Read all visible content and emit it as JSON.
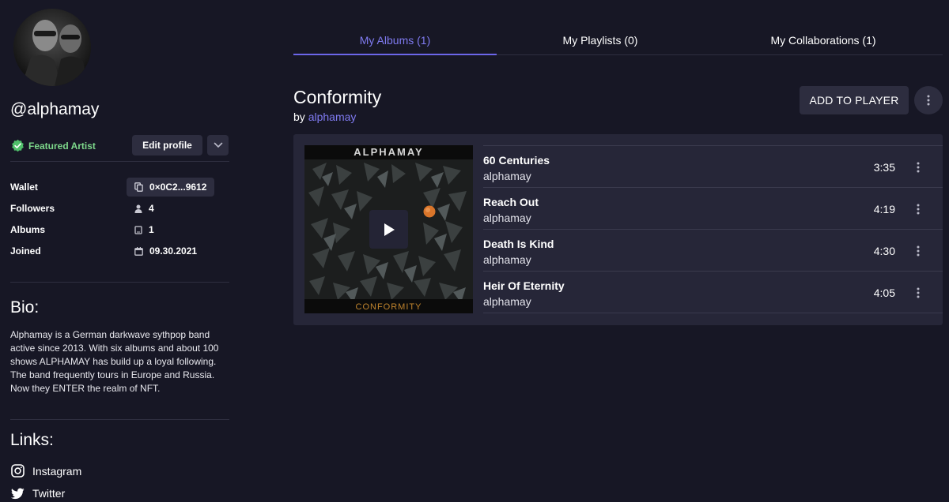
{
  "profile": {
    "username": "@alphamay",
    "featured_label": "Featured Artist",
    "edit_label": "Edit profile",
    "stats": {
      "wallet_label": "Wallet",
      "wallet_value": "0×0C2...9612",
      "followers_label": "Followers",
      "followers_value": "4",
      "albums_label": "Albums",
      "albums_value": "1",
      "joined_label": "Joined",
      "joined_value": "09.30.2021"
    },
    "bio_title": "Bio:",
    "bio": "Alphamay is a German darkwave sythpop band active since 2013. With six albums and about 100 shows ALPHAMAY has build up a loyal following. The band frequently tours in Europe and Russia. Now they ENTER the realm of NFT.",
    "links_title": "Links:",
    "links": [
      {
        "label": "Instagram",
        "icon": "instagram-icon"
      },
      {
        "label": "Twitter",
        "icon": "twitter-icon"
      }
    ]
  },
  "tabs": [
    {
      "label": "My Albums (1)",
      "active": true
    },
    {
      "label": "My Playlists (0)",
      "active": false
    },
    {
      "label": "My Collaborations (1)",
      "active": false
    }
  ],
  "album": {
    "title": "Conformity",
    "by_prefix": "by",
    "artist": "alphamay",
    "add_label": "ADD TO PLAYER",
    "cover_band": "ALPHAMAY",
    "cover_title": "CONFORMITY",
    "tracks": [
      {
        "name": "60 Centuries",
        "artist": "alphamay",
        "duration": "3:35"
      },
      {
        "name": "Reach Out",
        "artist": "alphamay",
        "duration": "4:19"
      },
      {
        "name": "Death Is Kind",
        "artist": "alphamay",
        "duration": "4:30"
      },
      {
        "name": "Heir Of Eternity",
        "artist": "alphamay",
        "duration": "4:05"
      }
    ]
  },
  "colors": {
    "background": "#171725",
    "accent": "#7f7af0",
    "featured": "#7dd88b",
    "panel": "#262638",
    "button": "#2d2d3f"
  }
}
